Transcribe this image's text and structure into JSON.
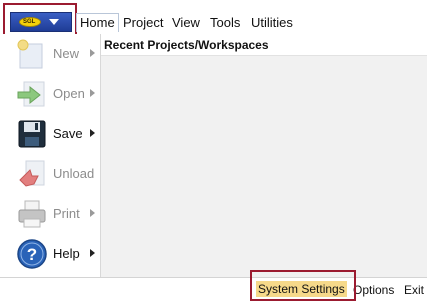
{
  "app_button": {
    "logo_text": "SGL",
    "icon": "app-menu-logo-icon"
  },
  "menubar": {
    "tabs": [
      "Home",
      "Project",
      "View",
      "Tools",
      "Utilities"
    ],
    "active_tab": "Home"
  },
  "backstage": {
    "items": [
      {
        "label": "New",
        "icon": "new-document-icon",
        "enabled": false,
        "has_submenu": true
      },
      {
        "label": "Open",
        "icon": "open-folder-icon",
        "enabled": false,
        "has_submenu": true
      },
      {
        "label": "Save",
        "icon": "save-disk-icon",
        "enabled": true,
        "has_submenu": true
      },
      {
        "label": "Unload",
        "icon": "unload-icon",
        "enabled": false,
        "has_submenu": false
      },
      {
        "label": "Print",
        "icon": "printer-icon",
        "enabled": false,
        "has_submenu": true
      },
      {
        "label": "Help",
        "icon": "help-icon",
        "enabled": true,
        "has_submenu": true
      }
    ]
  },
  "content": {
    "title": "Recent Projects/Workspaces"
  },
  "bottom": {
    "system_settings": "System Settings",
    "options": "Options",
    "exit": "Exit"
  },
  "colors": {
    "accent_highlight": "#9b1b30",
    "hover_fill": "#f6d98a",
    "app_button": "#2b4cab"
  }
}
